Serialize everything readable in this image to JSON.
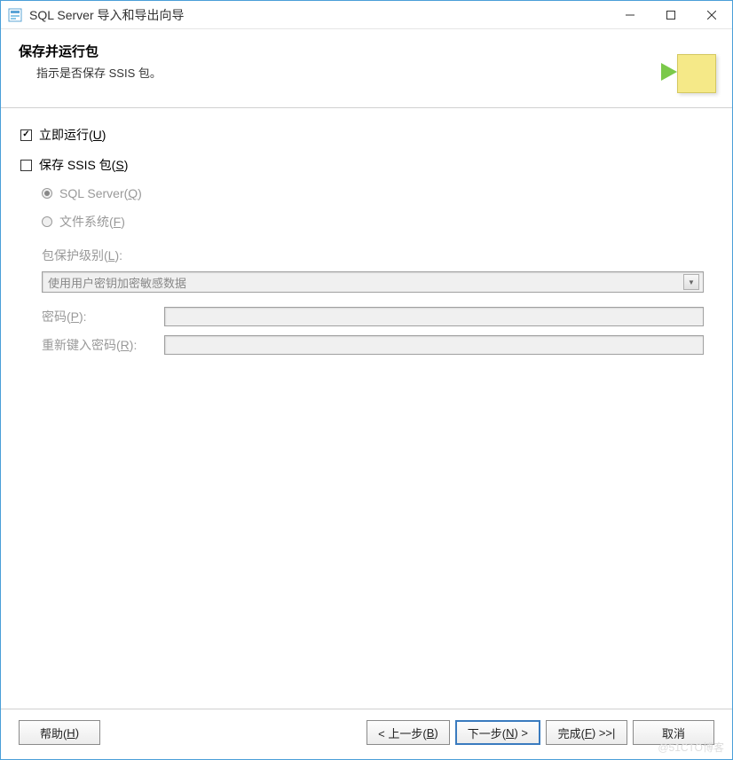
{
  "window": {
    "title": "SQL Server 导入和导出向导"
  },
  "header": {
    "title": "保存并运行包",
    "subtitle": "指示是否保存 SSIS 包。"
  },
  "options": {
    "run_now": {
      "label": "立即运行(",
      "hotkey": "U",
      "suffix": ")",
      "checked": true
    },
    "save_ssis": {
      "label": "保存 SSIS 包(",
      "hotkey": "S",
      "suffix": ")",
      "checked": false
    },
    "sql_server": {
      "label": "SQL Server(",
      "hotkey": "Q",
      "suffix": ")",
      "selected": true,
      "disabled": true
    },
    "file_system": {
      "label": "文件系统(",
      "hotkey": "F",
      "suffix": ")",
      "selected": false,
      "disabled": true
    }
  },
  "protection": {
    "label": "包保护级别(",
    "hotkey": "L",
    "suffix": "):",
    "dropdown_value": "使用用户密钥加密敏感数据",
    "password_label": "密码(",
    "password_hotkey": "P",
    "password_suffix": "):",
    "password_value": "",
    "retype_label": "重新键入密码(",
    "retype_hotkey": "R",
    "retype_suffix": "):",
    "retype_value": ""
  },
  "footer": {
    "help": "帮助(",
    "help_hotkey": "H",
    "help_suffix": ")",
    "back": "< 上一步(",
    "back_hotkey": "B",
    "back_suffix": ")",
    "next": "下一步(",
    "next_hotkey": "N",
    "next_suffix": ") >",
    "finish": "完成(",
    "finish_hotkey": "F",
    "finish_suffix": ") >>|",
    "cancel": "取消"
  },
  "watermark": "@51CTO博客"
}
